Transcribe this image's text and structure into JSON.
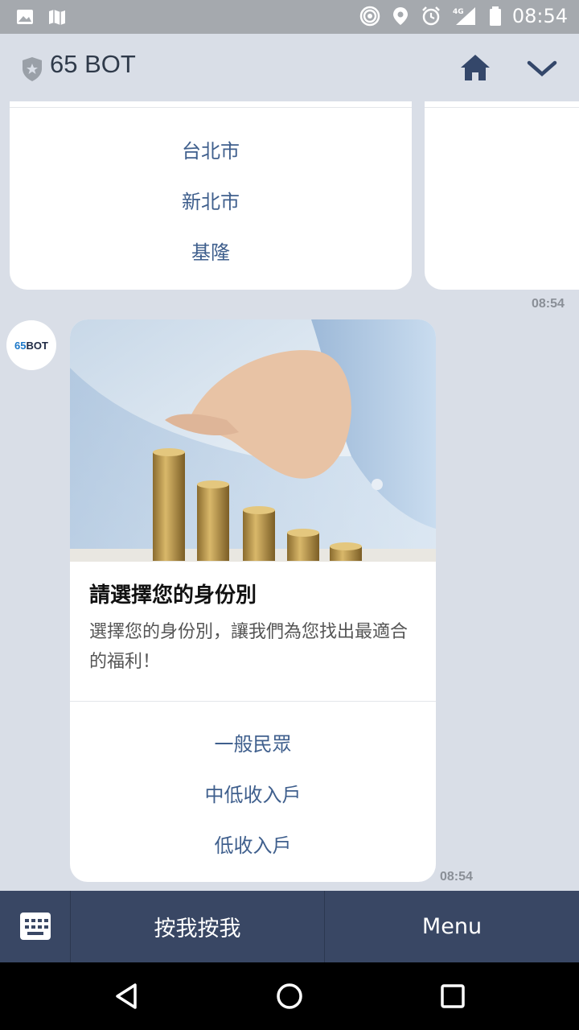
{
  "status_bar": {
    "time": "08:54",
    "network": "4G",
    "left_icons": [
      "image-icon",
      "map-icon"
    ],
    "right_icons": [
      "hotspot-icon",
      "location-icon",
      "alarm-icon",
      "signal-icon",
      "battery-icon"
    ]
  },
  "header": {
    "title": "65 BOT"
  },
  "chat": {
    "top_card": {
      "actions": [
        "台北市",
        "新北市",
        "基隆"
      ],
      "timestamp": "08:54"
    },
    "avatar": {
      "num": "65",
      "text": "BOT"
    },
    "card": {
      "title": "請選擇您的身份別",
      "description": "選擇您的身份別，讓我們為您找出最適合的福利！",
      "actions": [
        "一般民眾",
        "中低收入戶",
        "低收入戶"
      ],
      "timestamp": "08:54"
    }
  },
  "bottom_bar": {
    "button1": "按我按我",
    "button2": "Menu"
  },
  "colors": {
    "background": "#d9dee7",
    "accent": "#3f5f8d",
    "bottom_bar": "#394764",
    "status_bar": "#a5a9ae"
  }
}
